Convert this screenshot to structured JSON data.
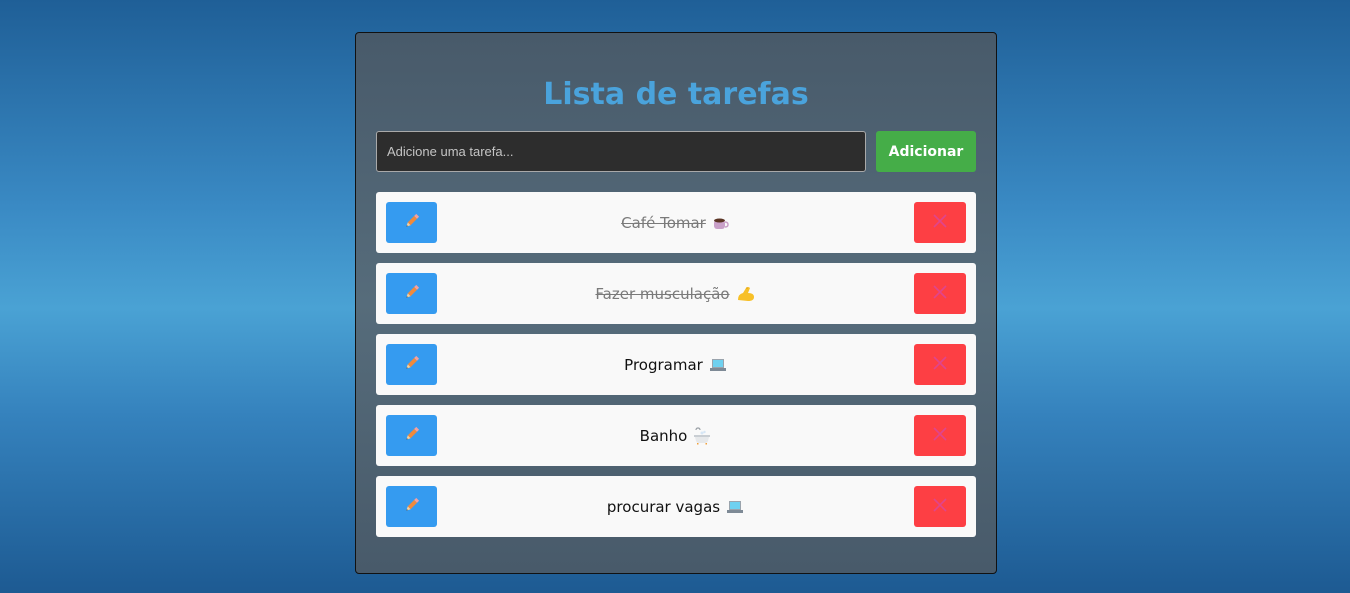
{
  "app": {
    "title": "Lista de tarefas"
  },
  "input": {
    "placeholder": "Adicione uma tarefa...",
    "value": ""
  },
  "add_button": {
    "label": "Adicionar"
  },
  "tasks": [
    {
      "text": "Café Tomar",
      "emoji_icon": "coffee-icon",
      "done": true
    },
    {
      "text": "Fazer musculação",
      "emoji_icon": "flexed-biceps-icon",
      "done": true
    },
    {
      "text": "Programar",
      "emoji_icon": "laptop-icon",
      "done": false
    },
    {
      "text": "Banho",
      "emoji_icon": "bathtub-icon",
      "done": false
    },
    {
      "text": "procurar vagas",
      "emoji_icon": "laptop-icon",
      "done": false
    }
  ],
  "colors": {
    "accent_title": "#4aa3dc",
    "add_button": "#45ad48",
    "edit_button": "#359bf0",
    "delete_button": "#fd3f44",
    "delete_icon": "#e0458c"
  }
}
